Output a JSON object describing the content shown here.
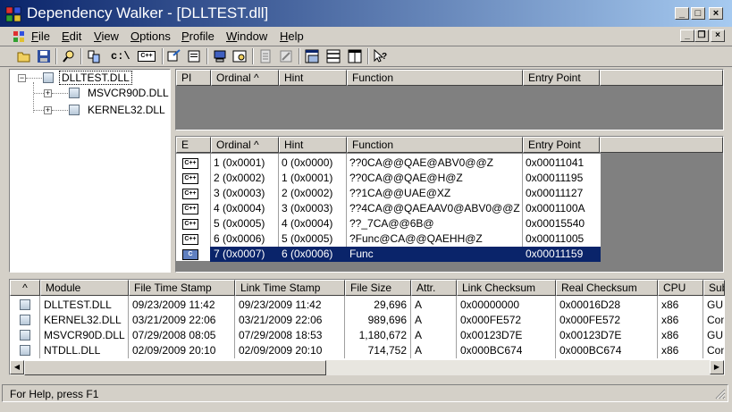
{
  "window": {
    "title": "Dependency Walker - [DLLTEST.dll]",
    "caption_buttons": {
      "minimize": "_",
      "maximize": "□",
      "close": "×"
    }
  },
  "menubar": {
    "items": [
      {
        "label": "File",
        "hotkey": "F"
      },
      {
        "label": "Edit",
        "hotkey": "E"
      },
      {
        "label": "View",
        "hotkey": "V"
      },
      {
        "label": "Options",
        "hotkey": "O"
      },
      {
        "label": "Profile",
        "hotkey": "P"
      },
      {
        "label": "Window",
        "hotkey": "W"
      },
      {
        "label": "Help",
        "hotkey": "H"
      }
    ],
    "mdi_buttons": {
      "minimize": "_",
      "restore": "❐",
      "close": "×"
    }
  },
  "toolbar": {
    "icons": [
      "open-icon",
      "save-icon",
      "find-icon",
      "copy-icon",
      "path-icon",
      "cpp-icon",
      "refresh-icon",
      "properties-icon",
      "system-info-icon",
      "view-full-paths-icon",
      "module-list-icon",
      "function-icon",
      "horizontal-split-icon",
      "vertical-split-icon",
      "help-icon"
    ],
    "c_label": "c:\\",
    "cpp_label": "C++"
  },
  "tree": {
    "items": [
      {
        "label": "DLLTEST.DLL",
        "level": 0,
        "expander": "−"
      },
      {
        "label": "MSVCR90D.DLL",
        "level": 1,
        "expander": "+"
      },
      {
        "label": "KERNEL32.DLL",
        "level": 1,
        "expander": "+"
      }
    ]
  },
  "imports": {
    "headers": [
      "PI",
      "Ordinal ^",
      "Hint",
      "Function",
      "Entry Point"
    ],
    "rows": []
  },
  "exports": {
    "headers": [
      "E",
      "Ordinal ^",
      "Hint",
      "Function",
      "Entry Point"
    ],
    "icon_label_cpp": "C++",
    "icon_label_c": "C",
    "rows": [
      {
        "ordinal": "1 (0x0001)",
        "hint": "0 (0x0000)",
        "function": "??0CA@@QAE@ABV0@@Z",
        "entry": "0x00011041",
        "selected": false
      },
      {
        "ordinal": "2 (0x0002)",
        "hint": "1 (0x0001)",
        "function": "??0CA@@QAE@H@Z",
        "entry": "0x00011195",
        "selected": false
      },
      {
        "ordinal": "3 (0x0003)",
        "hint": "2 (0x0002)",
        "function": "??1CA@@UAE@XZ",
        "entry": "0x00011127",
        "selected": false
      },
      {
        "ordinal": "4 (0x0004)",
        "hint": "3 (0x0003)",
        "function": "??4CA@@QAEAAV0@ABV0@@Z",
        "entry": "0x0001100A",
        "selected": false
      },
      {
        "ordinal": "5 (0x0005)",
        "hint": "4 (0x0004)",
        "function": "??_7CA@@6B@",
        "entry": "0x00015540",
        "selected": false
      },
      {
        "ordinal": "6 (0x0006)",
        "hint": "5 (0x0005)",
        "function": "?Func@CA@@QAEHH@Z",
        "entry": "0x00011005",
        "selected": false
      },
      {
        "ordinal": "7 (0x0007)",
        "hint": "6 (0x0006)",
        "function": "Func",
        "entry": "0x00011159",
        "selected": true
      }
    ]
  },
  "modules": {
    "headers": [
      "^",
      "Module",
      "File Time Stamp",
      "Link Time Stamp",
      "File Size",
      "Attr.",
      "Link Checksum",
      "Real Checksum",
      "CPU",
      "Sub"
    ],
    "rows": [
      {
        "module": "DLLTEST.DLL",
        "file_ts": "09/23/2009 11:42",
        "link_ts": "09/23/2009 11:42",
        "size": "29,696",
        "attr": "A",
        "link_cs": "0x00000000",
        "real_cs": "0x00016D28",
        "cpu": "x86",
        "sub": "GUI"
      },
      {
        "module": "KERNEL32.DLL",
        "file_ts": "03/21/2009 22:06",
        "link_ts": "03/21/2009 22:06",
        "size": "989,696",
        "attr": "A",
        "link_cs": "0x000FE572",
        "real_cs": "0x000FE572",
        "cpu": "x86",
        "sub": "Con"
      },
      {
        "module": "MSVCR90D.DLL",
        "file_ts": "07/29/2008 08:05",
        "link_ts": "07/29/2008 18:53",
        "size": "1,180,672",
        "attr": "A",
        "link_cs": "0x00123D7E",
        "real_cs": "0x00123D7E",
        "cpu": "x86",
        "sub": "GUI"
      },
      {
        "module": "NTDLL.DLL",
        "file_ts": "02/09/2009 20:10",
        "link_ts": "02/09/2009 20:10",
        "size": "714,752",
        "attr": "A",
        "link_cs": "0x000BC674",
        "real_cs": "0x000BC674",
        "cpu": "x86",
        "sub": "Con"
      }
    ]
  },
  "statusbar": {
    "text": "For Help, press F1"
  },
  "colors": {
    "titlebar_start": "#0a246a",
    "titlebar_end": "#a6caf0",
    "selection": "#0a246a",
    "face": "#d4d0c8"
  }
}
